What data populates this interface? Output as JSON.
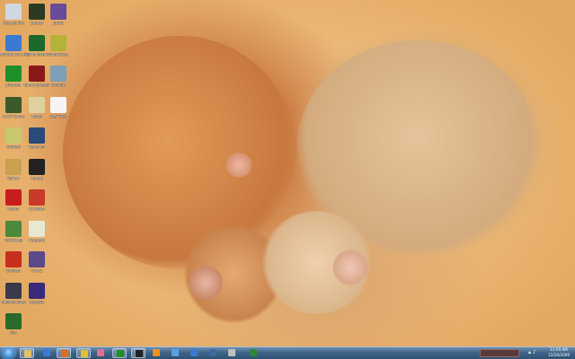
{
  "desktop": {
    "wallpaper": "two kittens sleeping in a heart shape",
    "icons": [
      {
        "label": "Recycle Bin",
        "icon": "recycle-bin-icon",
        "color": "#cfd8e0"
      },
      {
        "label": "Stalker",
        "icon": "game-icon",
        "color": "#2d3a22"
      },
      {
        "label": "prb02",
        "icon": "app-icon",
        "color": "#6a4a9a"
      },
      {
        "label": "Windows Live Messenger",
        "icon": "messenger-icon",
        "color": "#3a7ad0"
      },
      {
        "label": "Trillian Instant",
        "icon": "trillian-icon",
        "color": "#1b6a2a"
      },
      {
        "label": "CloneDrive",
        "icon": "clone-drive-icon",
        "color": "#b5b23a"
      },
      {
        "label": "µTorrent",
        "icon": "utorrent-icon",
        "color": "#1f8f2a"
      },
      {
        "label": "Game Booster",
        "icon": "booster-icon",
        "color": "#8a1a1a"
      },
      {
        "label": "Window",
        "icon": "window-icon",
        "color": "#7aa0b8"
      },
      {
        "label": "CCCP Codec",
        "icon": "codec-icon",
        "color": "#3a5a2a"
      },
      {
        "label": "Yahoo",
        "icon": "yahoo-icon",
        "color": "#e0d0a0"
      },
      {
        "label": "New Text",
        "icon": "document-icon",
        "color": "#f4f4f4"
      },
      {
        "label": "WinRAR",
        "icon": "winrar-icon",
        "color": "#c8c870"
      },
      {
        "label": "Hamachi",
        "icon": "hamachi-icon",
        "color": "#2a4a7a"
      },
      {
        "label": "Oblivion",
        "icon": "oblivion-icon",
        "color": "#4a3a2a"
      },
      {
        "label": "Fallout",
        "icon": "fallout-icon",
        "color": "#c8a050"
      },
      {
        "label": "Opera",
        "icon": "opera-icon",
        "color": "#c81e1e"
      },
      {
        "label": "Unreal",
        "icon": "unreal-icon",
        "color": "#222222"
      },
      {
        "label": "WHS Help",
        "icon": "help-icon",
        "color": "#4a8a3a"
      },
      {
        "label": "CCleaner",
        "icon": "ccleaner-icon",
        "color": "#c83a2a"
      },
      {
        "label": "Connect",
        "icon": "connect-icon",
        "color": "#c8301e"
      },
      {
        "label": "Notepad",
        "icon": "notepad-icon",
        "color": "#e8e8d0"
      },
      {
        "label": "MediaMonkey",
        "icon": "mediamonkey-icon",
        "color": "#3a3a4a"
      },
      {
        "label": "CPU-Z",
        "icon": "cpu-icon",
        "color": "#5a4a8a"
      },
      {
        "label": "GTA",
        "icon": "gta-icon",
        "color": "#2a6a2a"
      },
      {
        "label": "lang18n",
        "icon": "flag-icon",
        "color": "#3a2a7a"
      }
    ]
  },
  "taskbar": {
    "buttons": [
      {
        "name": "start-orb"
      },
      {
        "name": "explorer",
        "color": "#e8c060",
        "open": true
      },
      {
        "name": "media-player",
        "color": "#3a7ad0",
        "open": false
      },
      {
        "name": "firefox",
        "color": "#e06a20",
        "open": true
      },
      {
        "name": "chrome",
        "color": "#e0c030",
        "open": true
      },
      {
        "name": "flower-app",
        "color": "#e07090",
        "open": false
      },
      {
        "name": "utorrent",
        "color": "#1f8f2a",
        "open": true
      },
      {
        "name": "terminal",
        "color": "#222222",
        "open": true
      },
      {
        "name": "vlc",
        "color": "#f09020",
        "open": false
      },
      {
        "name": "network-app",
        "color": "#5aa0e0",
        "open": false
      },
      {
        "name": "folder-blue",
        "color": "#3a7ad0",
        "open": false
      },
      {
        "name": "task-app",
        "color": "#3a6aa0",
        "open": false
      },
      {
        "name": "monitor",
        "color": "#c0c0c0",
        "open": false
      },
      {
        "name": "usb-drive",
        "color": "#2a8a3a",
        "open": false
      }
    ],
    "clock_time": "11:59 AM",
    "clock_date": "12/26/2009"
  }
}
